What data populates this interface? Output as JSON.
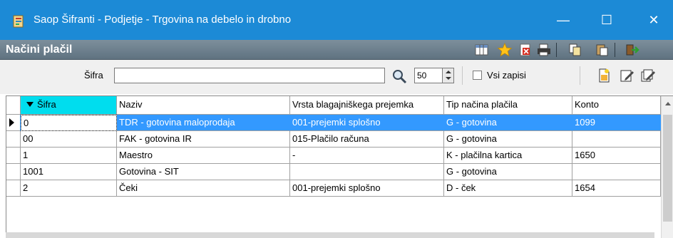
{
  "window": {
    "title": "Saop Šifranti - Podjetje - Trgovina na debelo in drobno",
    "minimize": "—",
    "maximize": "☐",
    "close": "✕",
    "title_bar_color": "#1c8ad6"
  },
  "form": {
    "title": "Načini plačil",
    "toolbar_icons": [
      "columns-icon",
      "star-icon",
      "delete-icon",
      "print-icon",
      "copy-icon",
      "paste-icon",
      "exit-icon"
    ]
  },
  "filter": {
    "label": "Šifra",
    "value": "",
    "record_count": "50",
    "show_all_label": "Vsi zapisi",
    "show_all_checked": false,
    "action_icons": [
      "new-record-icon",
      "edit-record-icon",
      "edit-multiple-icon"
    ]
  },
  "grid": {
    "columns": [
      "Šifra",
      "Naziv",
      "Vrsta blagajniškega prejemka",
      "Tip načina plačila",
      "Konto"
    ],
    "sorted_column": "Šifra",
    "rows": [
      {
        "sifra": "0",
        "naziv": "TDR - gotovina maloprodaja",
        "vrsta": "001-prejemki splošno",
        "tip": "G - gotovina",
        "konto": "1099",
        "selected": true
      },
      {
        "sifra": "00",
        "naziv": "FAK - gotovina IR",
        "vrsta": "015-Plačilo računa",
        "tip": "G - gotovina",
        "konto": "",
        "selected": false
      },
      {
        "sifra": "1",
        "naziv": "Maestro",
        "vrsta": "-",
        "tip": "K - plačilna kartica",
        "konto": "1650",
        "selected": false
      },
      {
        "sifra": "1001",
        "naziv": "Gotovina - SIT",
        "vrsta": "",
        "tip": "G - gotovina",
        "konto": "",
        "selected": false
      },
      {
        "sifra": "2",
        "naziv": "Čeki",
        "vrsta": "001-prejemki splošno",
        "tip": "D - ček",
        "konto": "1654",
        "selected": false
      }
    ],
    "selection_color": "#3399ff",
    "sort_header_color": "#00ddee"
  }
}
